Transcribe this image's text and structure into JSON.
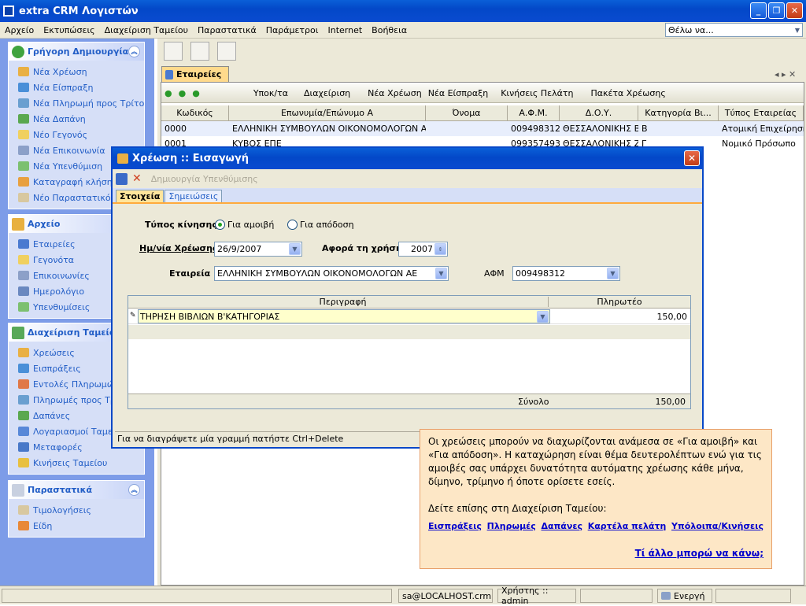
{
  "window": {
    "title": "extra CRM Λογιστών",
    "minimize_glyph": "_",
    "restore_glyph": "❐",
    "close_glyph": "✕"
  },
  "menu": {
    "items": [
      "Αρχείο",
      "Εκτυπώσεις",
      "Διαχείριση Ταμείου",
      "Παραστατικά",
      "Παράμετροι",
      "Internet",
      "Βοήθεια"
    ],
    "search_placeholder": "Θέλω να...",
    "search_arrow": "▼"
  },
  "sidebar": {
    "quick_create": {
      "title": "Γρήγορη Δημιουργία",
      "items": [
        "Νέα Χρέωση",
        "Νέα Είσπραξη",
        "Νέα Πληρωμή προς Τρίτους",
        "Νέα Δαπάνη",
        "Νέο Γεγονός",
        "Νέα Επικοινωνία",
        "Νέα Υπενθύμιση",
        "Καταγραφή κλήσης",
        "Νέο Παραστατικό Πα"
      ]
    },
    "file": {
      "title": "Αρχείο",
      "items": [
        "Εταιρείες",
        "Γεγονότα",
        "Επικοινωνίες",
        "Ημερολόγιο",
        "Υπενθυμίσεις"
      ]
    },
    "cash": {
      "title": "Διαχείριση Ταμείου",
      "items": [
        "Χρεώσεις",
        "Εισπράξεις",
        "Εντολές Πληρωμών",
        "Πληρωμές προς Τρίτ",
        "Δαπάνες",
        "Λογαριασμοί Ταμείου",
        "Μεταφορές",
        "Κινήσεις Ταμείου"
      ]
    },
    "docs": {
      "title": "Παραστατικά",
      "items": [
        "Τιμολογήσεις",
        "Είδη"
      ]
    },
    "collapse_glyph": "︽"
  },
  "main": {
    "doc_tab": "Εταιρείες",
    "tab_nav": "◂ ▸ ✕",
    "grid_toolbar": [
      "Υποκ/τα",
      "Διαχείριση",
      "Νέα Χρέωση",
      "Νέα Είσπραξη",
      "Κινήσεις Πελάτη",
      "Πακέτα Χρέωσης"
    ],
    "columns": [
      "Κωδικός",
      "Επωνυμία/Επώνυμο Α",
      "Όνομα",
      "Α.Φ.Μ.",
      "Δ.Ο.Υ.",
      "Κατηγορία Βι...",
      "Τύπος Εταιρείας"
    ],
    "rows": [
      [
        "0000",
        "ΕΛΛΗΝΙΚΗ ΣΥΜΒΟΥΛΩΝ ΟΙΚΟΝΟΜΟΛΟΓΩΝ ΑΕ",
        "",
        "009498312",
        "ΘΕΣΣΑΛΟΝΙΚΗΣ Β'",
        "Β",
        "Ατομική Επιχείρηση"
      ],
      [
        "0001",
        "ΚΥΒΟΣ ΕΠΕ",
        "",
        "099357493",
        "ΘΕΣΣΑΛΟΝΙΚΗΣ Ζ'",
        "Γ",
        "Νομικό Πρόσωπο"
      ]
    ]
  },
  "dialog": {
    "title": "Χρέωση :: Εισαγωγή",
    "close_glyph": "✕",
    "toolbar_disabled": "Δημιουργία Υπενθύμισης",
    "tabs": [
      "Στοιχεία",
      "Σημειώσεις"
    ],
    "labels": {
      "movement_type": "Τύπος κίνησης",
      "date": "Ημ/νία Χρέωσης",
      "year": "Αφορά τη χρήση",
      "company": "Εταιρεία",
      "afm": "ΑΦΜ"
    },
    "radio": {
      "fee": "Για αμοιβή",
      "refund": "Για απόδοση"
    },
    "values": {
      "date": "26/9/2007",
      "year": "2007",
      "company": "ΕΛΛΗΝΙΚΗ ΣΥΜΒΟΥΛΩΝ ΟΙΚΟΝΟΜΟΛΟΓΩΝ ΑΕ",
      "afm": "009498312"
    },
    "grid": {
      "col_desc": "Περιγραφή",
      "col_paid": "Πληρωτέο",
      "row_desc": "ΤΗΡΗΣΗ ΒΙΒΛΙΩΝ Β'ΚΑΤΗΓΟΡΙΑΣ",
      "row_amount": "150,00",
      "total_label": "Σύνολο",
      "total": "150,00"
    },
    "status": "Για να διαγράψετε μία γραμμή πατήστε Ctrl+Delete"
  },
  "tip": {
    "text": "Οι χρεώσεις μπορούν να διαχωρίζονται ανάμεσα σε «Για αμοιβή» και «Για απόδοση». Η καταχώρηση είναι θέμα δευτερολέπτων ενώ για τις αμοιβές σας υπάρχει δυνατότητα αυτόματης χρέωσης κάθε μήνα, δίμηνο, τρίμηνο ή όποτε ορίσετε εσείς.",
    "see_also": "Δείτε επίσης στη Διαχείριση Ταμείου:",
    "links": [
      "Εισπράξεις",
      "Πληρωμές",
      "Δαπάνες",
      "Καρτέλα πελάτη",
      "Υπόλοιπα/Κινήσεις"
    ],
    "more": "Τί άλλο μπορώ να κάνω;"
  },
  "status": {
    "connection": "sa@LOCALHOST.crm",
    "user": "Χρήστης :: admin",
    "state": "Ενεργή"
  }
}
